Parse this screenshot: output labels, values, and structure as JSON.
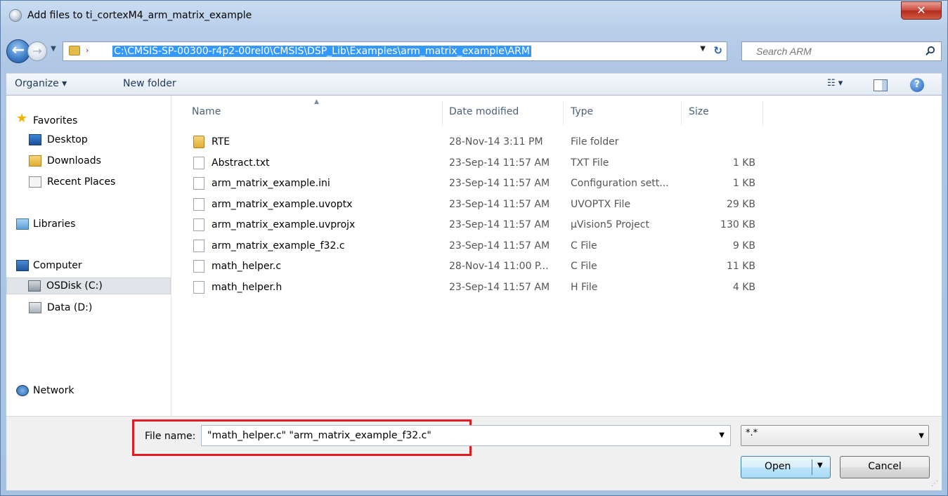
{
  "window": {
    "title": "Add files to ti_cortexM4_arm_matrix_example",
    "close_glyph": "✕"
  },
  "nav": {
    "back_glyph": "←",
    "forward_glyph": "→",
    "address": "C:\\CMSIS-SP-00300-r4p2-00rel0\\CMSIS\\DSP_Lib\\Examples\\arm_matrix_example\\ARM",
    "search_placeholder": "Search ARM"
  },
  "toolbar": {
    "organize": "Organize ▾",
    "new_folder": "New folder"
  },
  "sidebar": {
    "favorites": "Favorites",
    "desktop": "Desktop",
    "downloads": "Downloads",
    "recent_places": "Recent Places",
    "libraries": "Libraries",
    "computer": "Computer",
    "osdisk": "OSDisk (C:)",
    "data": "Data (D:)",
    "network": "Network"
  },
  "columns": {
    "name": "Name",
    "date": "Date modified",
    "type": "Type",
    "size": "Size"
  },
  "files": [
    {
      "name": "RTE",
      "date": "28-Nov-14 3:11 PM",
      "type": "File folder",
      "size": "",
      "icon": "folder-icon"
    },
    {
      "name": "Abstract.txt",
      "date": "23-Sep-14 11:57 AM",
      "type": "TXT File",
      "size": "1 KB",
      "icon": "text-file-icon"
    },
    {
      "name": "arm_matrix_example.ini",
      "date": "23-Sep-14 11:57 AM",
      "type": "Configuration sett...",
      "size": "1 KB",
      "icon": "config-file-icon"
    },
    {
      "name": "arm_matrix_example.uvoptx",
      "date": "23-Sep-14 11:57 AM",
      "type": "UVOPTX File",
      "size": "29 KB",
      "icon": "blank-file-icon"
    },
    {
      "name": "arm_matrix_example.uvprojx",
      "date": "23-Sep-14 11:57 AM",
      "type": "µVision5 Project",
      "size": "130 KB",
      "icon": "uvision-project-icon"
    },
    {
      "name": "arm_matrix_example_f32.c",
      "date": "23-Sep-14 11:57 AM",
      "type": "C File",
      "size": "9 KB",
      "icon": "c-file-icon"
    },
    {
      "name": "math_helper.c",
      "date": "28-Nov-14 11:00 P...",
      "type": "C File",
      "size": "11 KB",
      "icon": "c-file-icon"
    },
    {
      "name": "math_helper.h",
      "date": "23-Sep-14 11:57 AM",
      "type": "H File",
      "size": "4 KB",
      "icon": "h-file-icon"
    }
  ],
  "footer": {
    "file_name_label": "File name:",
    "file_name_value": "\"math_helper.c\" \"arm_matrix_example_f32.c\"",
    "filter_value": "*.*",
    "open_label": "Open",
    "cancel_label": "Cancel"
  },
  "colors": {
    "highlight_box": "#e01b24",
    "address_selection": "#3399ff"
  }
}
